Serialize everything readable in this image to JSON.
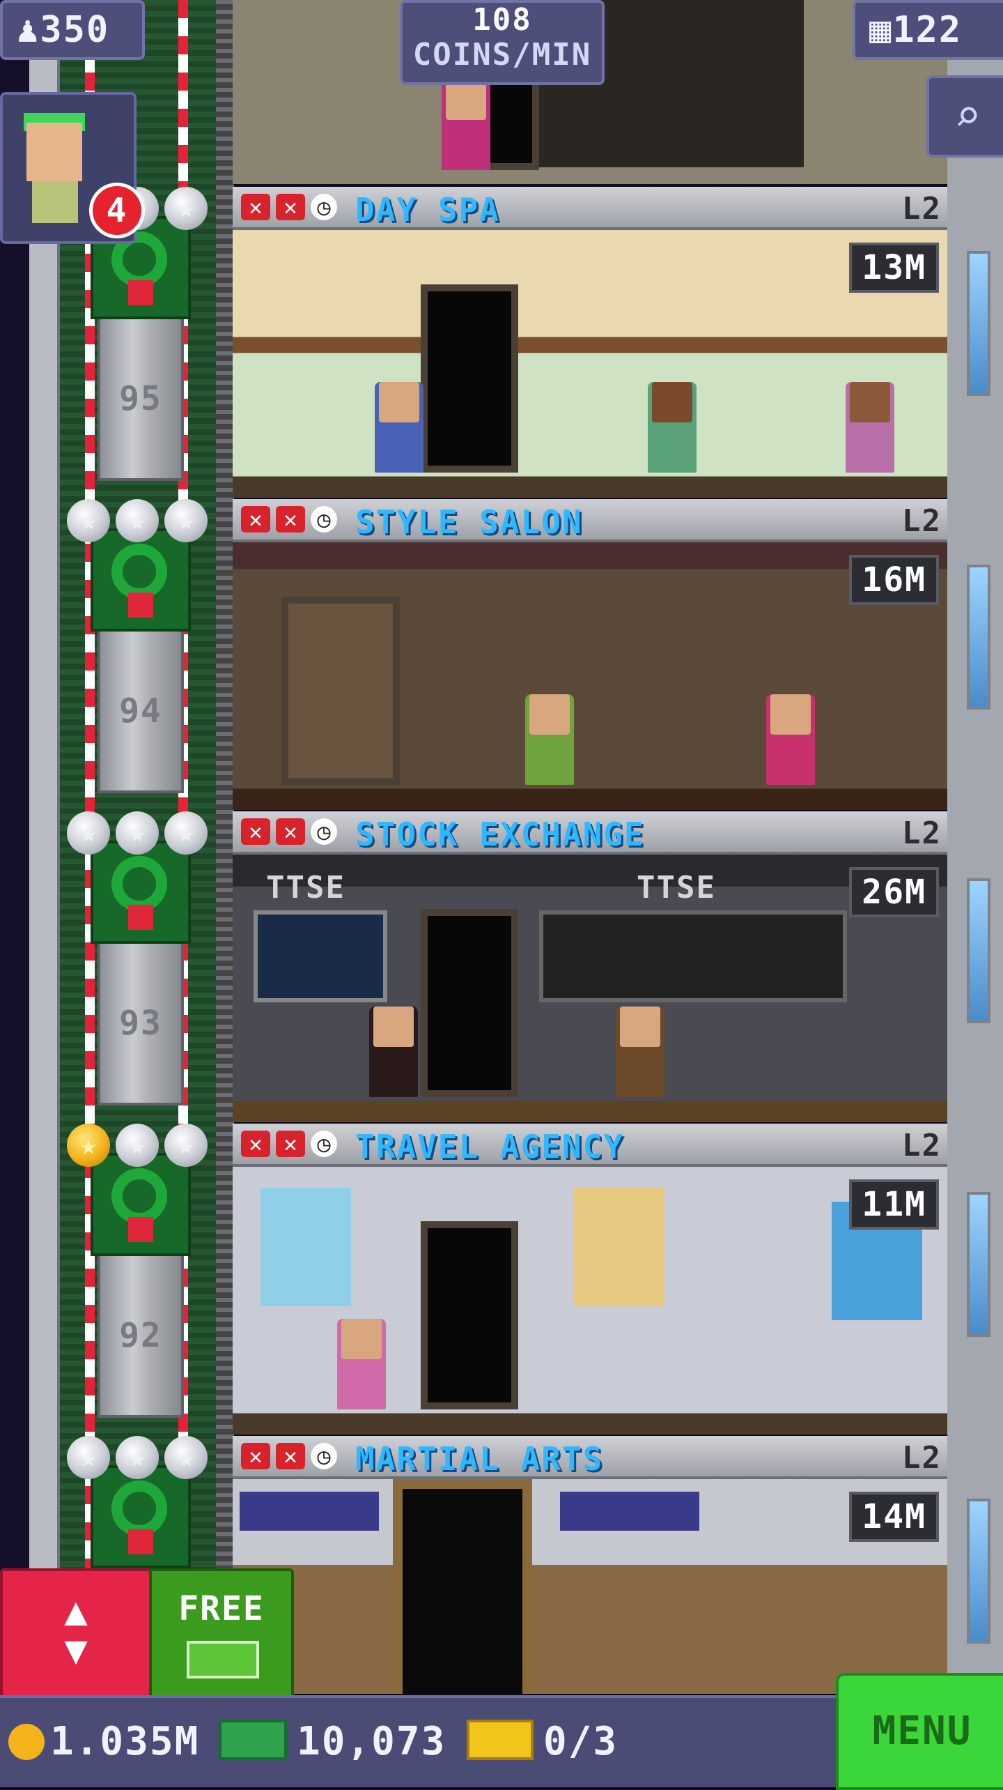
{
  "hud": {
    "population": "350",
    "coins_per_min_value": "108",
    "coins_per_min_label": "COINS/MIN",
    "floors_count": "122",
    "visitor_badge": "4"
  },
  "elevator": {
    "floor_numbers": [
      "95",
      "94",
      "93",
      "92"
    ]
  },
  "floors": [
    {
      "name": "DAY SPA",
      "level": "L2",
      "value": "13M",
      "stars_gold": 0
    },
    {
      "name": "STYLE SALON",
      "level": "L2",
      "value": "16M",
      "stars_gold": 0
    },
    {
      "name": "STOCK EXCHANGE",
      "level": "L2",
      "value": "26M",
      "stars_gold": 0
    },
    {
      "name": "TRAVEL AGENCY",
      "level": "L2",
      "value": "11M",
      "stars_gold": 1
    },
    {
      "name": "MARTIAL ARTS",
      "level": "L2",
      "value": "14M",
      "stars_gold": 0
    }
  ],
  "stock_exchange_signs": [
    "TTSE",
    "TTSE"
  ],
  "buttons": {
    "free_label": "FREE",
    "menu_label": "MENU"
  },
  "bottom_bar": {
    "coins": "1.035M",
    "bux": "10,073",
    "vip": "0/3"
  },
  "colors": {
    "floor_name": "#2fb7ff",
    "hud_bg": "#4d4f7a",
    "menu_green": "#3bd63a",
    "elevator_red": "#e5244a"
  }
}
